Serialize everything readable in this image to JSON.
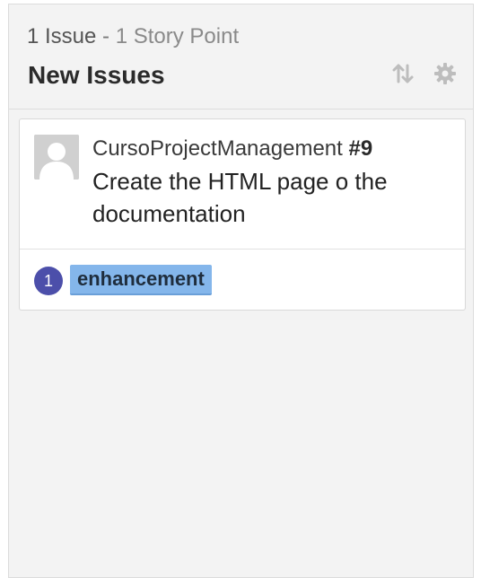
{
  "column": {
    "summary": {
      "issues": "1 Issue",
      "separator": " - ",
      "points": "1 Story Point"
    },
    "title": "New Issues",
    "actions": {
      "sort_icon": "sort-arrows-icon",
      "settings_icon": "gear-icon"
    }
  },
  "card": {
    "repo": "CursoProjectManagement",
    "number": "#9",
    "title": "Create the HTML page o the documentation",
    "story_points": "1",
    "labels": [
      {
        "name": "enhancement",
        "color": "#84b6eb"
      }
    ]
  },
  "colors": {
    "column_bg": "#f3f3f3",
    "points_badge": "#4c4faa",
    "enhancement_label": "#84b6eb"
  }
}
